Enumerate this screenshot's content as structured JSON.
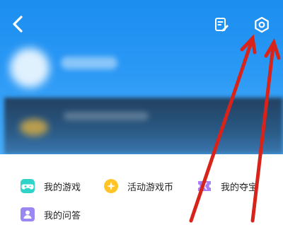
{
  "header": {
    "back_icon": "chevron-left-icon",
    "edit_icon": "edit-note-icon",
    "settings_icon": "settings-hexagon-icon"
  },
  "menu": {
    "items": [
      {
        "label": "我的游戏",
        "icon": "gamepad-icon",
        "color": "#2ed3c9"
      },
      {
        "label": "活动游戏币",
        "icon": "coin-icon",
        "color": "#ffc526"
      },
      {
        "label": "我的夺宝",
        "icon": "ticket-icon",
        "color": "#a87ff7"
      },
      {
        "label": "我的问答",
        "icon": "user-card-icon",
        "color": "#9b86f2"
      }
    ]
  },
  "colors": {
    "header_top": "#1b8ef0",
    "annotation_arrow": "#d8231b"
  }
}
